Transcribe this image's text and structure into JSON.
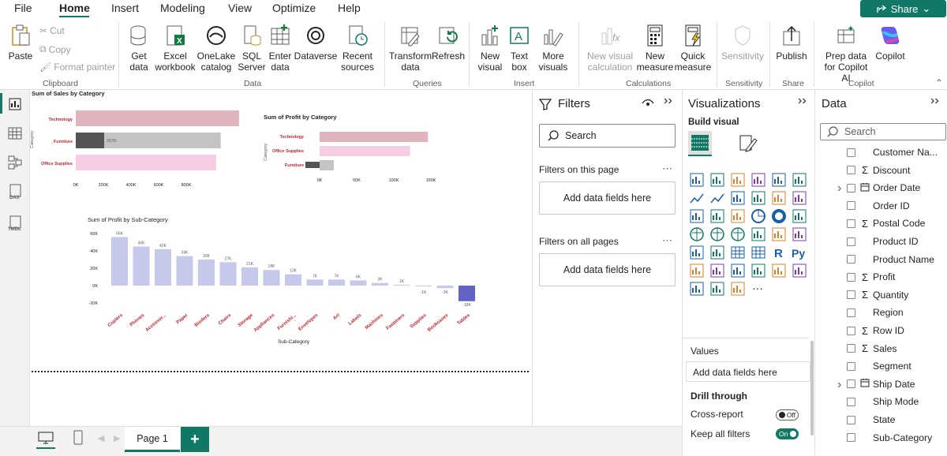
{
  "menu": {
    "items": [
      "File",
      "Home",
      "Insert",
      "Modeling",
      "View",
      "Optimize",
      "Help"
    ],
    "share": "Share"
  },
  "ribbon": {
    "clipboard": {
      "paste": "Paste",
      "cut": "Cut",
      "copy": "Copy",
      "format_painter": "Format painter",
      "group": "Clipboard"
    },
    "data": {
      "get_data": "Get data",
      "excel": "Excel workbook",
      "onelake": "OneLake catalog",
      "sql": "SQL Server",
      "enter_data": "Enter data",
      "dataverse": "Dataverse",
      "recent": "Recent sources",
      "group": "Data"
    },
    "queries": {
      "transform": "Transform data",
      "refresh": "Refresh",
      "group": "Queries"
    },
    "insert": {
      "new_visual": "New visual",
      "text_box": "Text box",
      "more_visuals": "More visuals",
      "group": "Insert"
    },
    "calculations": {
      "new_visual_calc": "New visual calculation",
      "new_measure": "New measure",
      "quick_measure": "Quick measure",
      "group": "Calculations"
    },
    "sensitivity": {
      "label": "Sensitivity",
      "group": "Sensitivity"
    },
    "share": {
      "publish": "Publish",
      "group": "Share"
    },
    "copilot": {
      "prep": "Prep data for Copilot AI",
      "copilot": "Copilot",
      "group": "Copilot"
    }
  },
  "filters": {
    "title": "Filters",
    "search": "Search",
    "on_page": "Filters on this page",
    "all_pages": "Filters on all pages",
    "add_fields": "Add data fields here"
  },
  "visualizations": {
    "title": "Visualizations",
    "build": "Build visual",
    "values": "Values",
    "add_fields": "Add data fields here",
    "drill": "Drill through",
    "cross_report": "Cross-report",
    "cross_state": "Off",
    "keep_filters": "Keep all filters",
    "keep_state": "On"
  },
  "data_pane": {
    "title": "Data",
    "search": "Search",
    "fields": [
      {
        "name": "Customer Na...",
        "sigma": false,
        "expand": false
      },
      {
        "name": "Discount",
        "sigma": true,
        "expand": false
      },
      {
        "name": "Order Date",
        "sigma": false,
        "expand": true,
        "calendar": true
      },
      {
        "name": "Order ID",
        "sigma": false,
        "expand": false
      },
      {
        "name": "Postal Code",
        "sigma": true,
        "expand": false
      },
      {
        "name": "Product ID",
        "sigma": false,
        "expand": false
      },
      {
        "name": "Product Name",
        "sigma": false,
        "expand": false
      },
      {
        "name": "Profit",
        "sigma": true,
        "expand": false
      },
      {
        "name": "Quantity",
        "sigma": true,
        "expand": false
      },
      {
        "name": "Region",
        "sigma": false,
        "expand": false
      },
      {
        "name": "Row ID",
        "sigma": true,
        "expand": false
      },
      {
        "name": "Sales",
        "sigma": true,
        "expand": false
      },
      {
        "name": "Segment",
        "sigma": false,
        "expand": false
      },
      {
        "name": "Ship Date",
        "sigma": false,
        "expand": true,
        "calendar": true
      },
      {
        "name": "Ship Mode",
        "sigma": false,
        "expand": false
      },
      {
        "name": "State",
        "sigma": false,
        "expand": false
      },
      {
        "name": "Sub-Category",
        "sigma": false,
        "expand": false
      }
    ]
  },
  "page_tab": {
    "label": "Page 1",
    "add": "+"
  },
  "colors": {
    "accent": "#117865",
    "bar_pink": "#e0b4bd",
    "bar_gray": "#c4c4c4",
    "bar_dark": "#555555",
    "bar_light_pink": "#f7cde3",
    "bar_lavender": "#c6c9ec",
    "bar_blue": "#6264c4",
    "label_red": "#c0242e"
  },
  "chart_data": [
    {
      "type": "bar",
      "title": "Sum of Sales by Category",
      "ylabel": "Category",
      "categories": [
        "Technology",
        "Furniture",
        "Office Supplies"
      ],
      "values": [
        836000,
        742000,
        719000
      ],
      "data_labels": [
        "",
        "207K",
        ""
      ],
      "ticks": [
        "0K",
        "200K",
        "400K",
        "600K",
        "800K"
      ],
      "xlim": [
        0,
        800000
      ]
    },
    {
      "type": "bar",
      "title": "Sum of Profit by Category",
      "ylabel": "Category",
      "categories": [
        "Technology",
        "Office Supplies",
        "Furniture"
      ],
      "values": [
        146000,
        122000,
        18000
      ],
      "ticks": [
        "0K",
        "50K",
        "100K",
        "150K"
      ],
      "xlim": [
        0,
        150000
      ]
    },
    {
      "type": "bar",
      "title": "Sum of Profit by Sub-Category",
      "xlabel": "Sub-Category",
      "categories": [
        "Copiers",
        "Phones",
        "Accessor...",
        "Paper",
        "Binders",
        "Chairs",
        "Storage",
        "Appliances",
        "Furnishi...",
        "Envelopes",
        "Art",
        "Labels",
        "Machines",
        "Fasteners",
        "Supplies",
        "Bookcases",
        "Tables"
      ],
      "values": [
        56,
        45,
        42,
        34,
        30,
        27,
        21,
        18,
        13,
        7,
        7,
        6,
        3,
        1,
        -1,
        -3,
        -18
      ],
      "data_labels": [
        "56K",
        "45K",
        "42K",
        "34K",
        "30K",
        "27K",
        "21K",
        "18K",
        "13K",
        "7K",
        "7K",
        "6K",
        "3K",
        "1K",
        "-1K",
        "-3K",
        "-18K"
      ],
      "ticks": [
        "60K",
        "40K",
        "20K",
        "0K",
        "-20K"
      ],
      "ylim": [
        -20,
        60
      ]
    }
  ]
}
